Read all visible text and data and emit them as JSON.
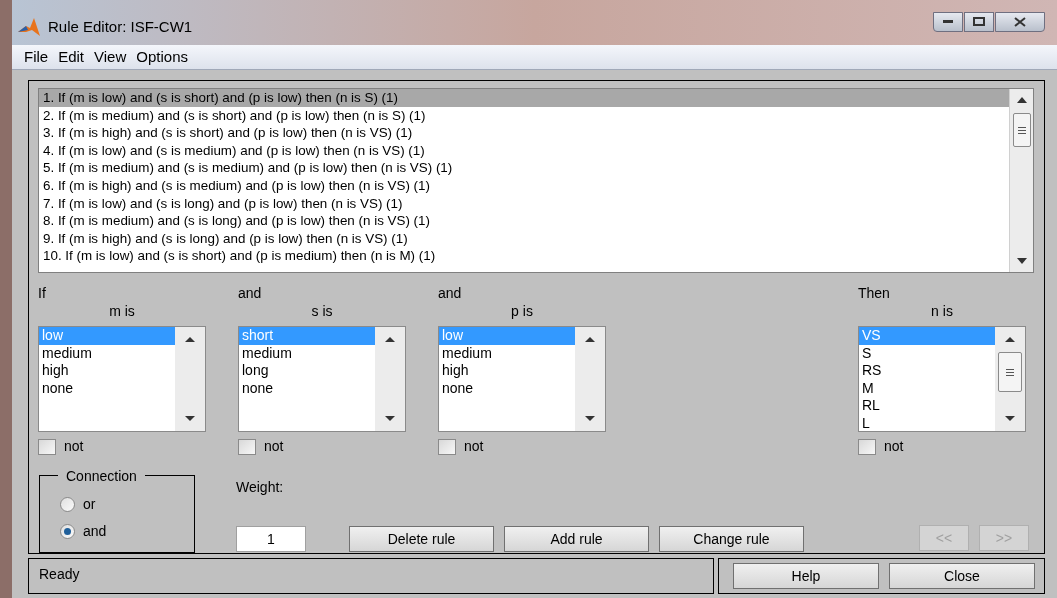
{
  "window": {
    "title": "Rule Editor: ISF-CW1"
  },
  "menu": [
    "File",
    "Edit",
    "View",
    "Options"
  ],
  "rules": [
    {
      "text": "1. If (m is low) and (s is short) and (p is low) then (n is S) (1)",
      "selected": true
    },
    {
      "text": "2. If (m is medium) and (s is short) and (p is low) then (n is S) (1)",
      "selected": false
    },
    {
      "text": "3. If (m is high) and (s is short) and (p is low) then (n is VS) (1)",
      "selected": false
    },
    {
      "text": "4. If (m is low) and (s is medium) and (p is low) then (n is VS) (1)",
      "selected": false
    },
    {
      "text": "5. If (m is medium) and (s is medium) and (p is low) then (n is VS) (1)",
      "selected": false
    },
    {
      "text": "6. If (m is high) and (s is medium) and (p is low) then (n is VS) (1)",
      "selected": false
    },
    {
      "text": "7. If (m is low) and (s is long) and (p is low) then (n is VS) (1)",
      "selected": false
    },
    {
      "text": "8. If (m is medium) and (s is long) and (p is low) then (n is VS) (1)",
      "selected": false
    },
    {
      "text": "9. If (m is high) and (s is long) and (p is low) then (n is VS) (1)",
      "selected": false
    },
    {
      "text": "10. If (m is low) and (s is short) and (p is medium) then (n is M) (1)",
      "selected": false
    }
  ],
  "columns": [
    {
      "connector": "If",
      "variable": "m is",
      "items": [
        {
          "label": "low",
          "selected": true
        },
        {
          "label": "medium",
          "selected": false
        },
        {
          "label": "high",
          "selected": false
        },
        {
          "label": "none",
          "selected": false
        }
      ],
      "not_label": "not",
      "not_checked": false
    },
    {
      "connector": "and",
      "variable": "s is",
      "items": [
        {
          "label": "short",
          "selected": true
        },
        {
          "label": "medium",
          "selected": false
        },
        {
          "label": "long",
          "selected": false
        },
        {
          "label": "none",
          "selected": false
        }
      ],
      "not_label": "not",
      "not_checked": false
    },
    {
      "connector": "and",
      "variable": "p is",
      "items": [
        {
          "label": "low",
          "selected": true
        },
        {
          "label": "medium",
          "selected": false
        },
        {
          "label": "high",
          "selected": false
        },
        {
          "label": "none",
          "selected": false
        }
      ],
      "not_label": "not",
      "not_checked": false
    },
    {
      "connector": "Then",
      "variable": "n is",
      "items": [
        {
          "label": "VS",
          "selected": true
        },
        {
          "label": "S",
          "selected": false
        },
        {
          "label": "RS",
          "selected": false
        },
        {
          "label": "M",
          "selected": false
        },
        {
          "label": "RL",
          "selected": false
        },
        {
          "label": "L",
          "selected": false
        }
      ],
      "not_label": "not",
      "not_checked": false
    }
  ],
  "connection": {
    "title": "Connection",
    "options": [
      {
        "label": "or",
        "selected": false
      },
      {
        "label": "and",
        "selected": true
      }
    ]
  },
  "weight": {
    "label": "Weight:",
    "value": "1"
  },
  "rule_buttons": [
    {
      "label": "Delete rule",
      "disabled": false
    },
    {
      "label": "Add rule",
      "disabled": false
    },
    {
      "label": "Change rule",
      "disabled": false
    }
  ],
  "nav_buttons": [
    {
      "label": "<<",
      "disabled": true
    },
    {
      "label": ">>",
      "disabled": true
    }
  ],
  "status": "Ready",
  "footer_buttons": [
    "Help",
    "Close"
  ]
}
